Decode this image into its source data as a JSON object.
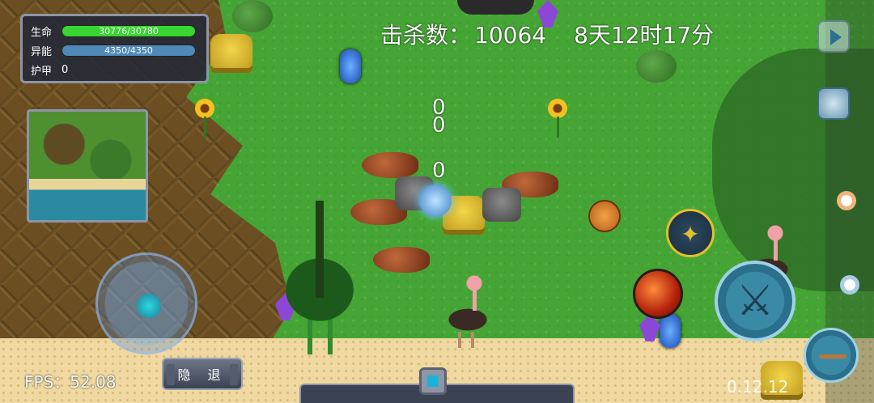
{
  "hud": {
    "stats": {
      "hp_label": "生命",
      "hp_text": "30776/30780",
      "hp_fraction": 0.9999,
      "energy_label": "异能",
      "energy_text": "4350/4350",
      "energy_fraction": 1.0,
      "armor_label": "护甲",
      "armor_value": "0"
    },
    "kill_label": "击杀数：",
    "kill_count": "10064",
    "game_time": "8天12时17分",
    "fps_label": "FPS：",
    "fps_value": "52.08",
    "hide_button_label": "隐 退",
    "version": "0.12.12"
  },
  "damage_numbers": [
    "0",
    "0",
    "0"
  ],
  "colors": {
    "hp_bar": "#37d631",
    "energy_bar": "#4f89b8",
    "grass": "#45a534",
    "panel": "#232837"
  },
  "icons": {
    "play": "play-icon",
    "backpack": "backpack-icon",
    "character": "character-icon",
    "fireball": "fireball-skill-icon",
    "attack": "crossed-swords-icon",
    "dash": "dash-skill-icon"
  }
}
